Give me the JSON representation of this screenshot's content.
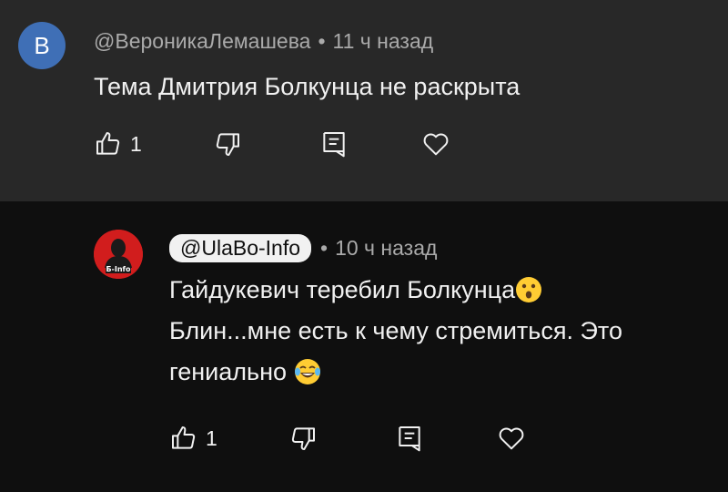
{
  "comments": [
    {
      "avatar_letter": "В",
      "avatar_color": "#3f6fb6",
      "handle": "@ВероникаЛемашева",
      "separator": "•",
      "time": "11 ч назад",
      "text": "Тема Дмитрия Болкунца не раскрыта",
      "likes": "1"
    },
    {
      "avatar_label": "Б-Info",
      "avatar_color": "#d11d1d",
      "handle": "@UlaBo-Info",
      "separator": "•",
      "time": "10 ч назад",
      "text_line1": "Гайдукевич теребил Болкунца",
      "text_line2": "Блин...мне есть к чему стремиться. Это",
      "text_line3": "гениально",
      "likes": "1"
    }
  ],
  "icons": {
    "like": "thumbs-up-icon",
    "dislike": "thumbs-down-icon",
    "reply": "reply-icon",
    "heart": "heart-icon",
    "emoji1": "astonished-face-emoji",
    "emoji2": "tears-of-joy-emoji"
  }
}
